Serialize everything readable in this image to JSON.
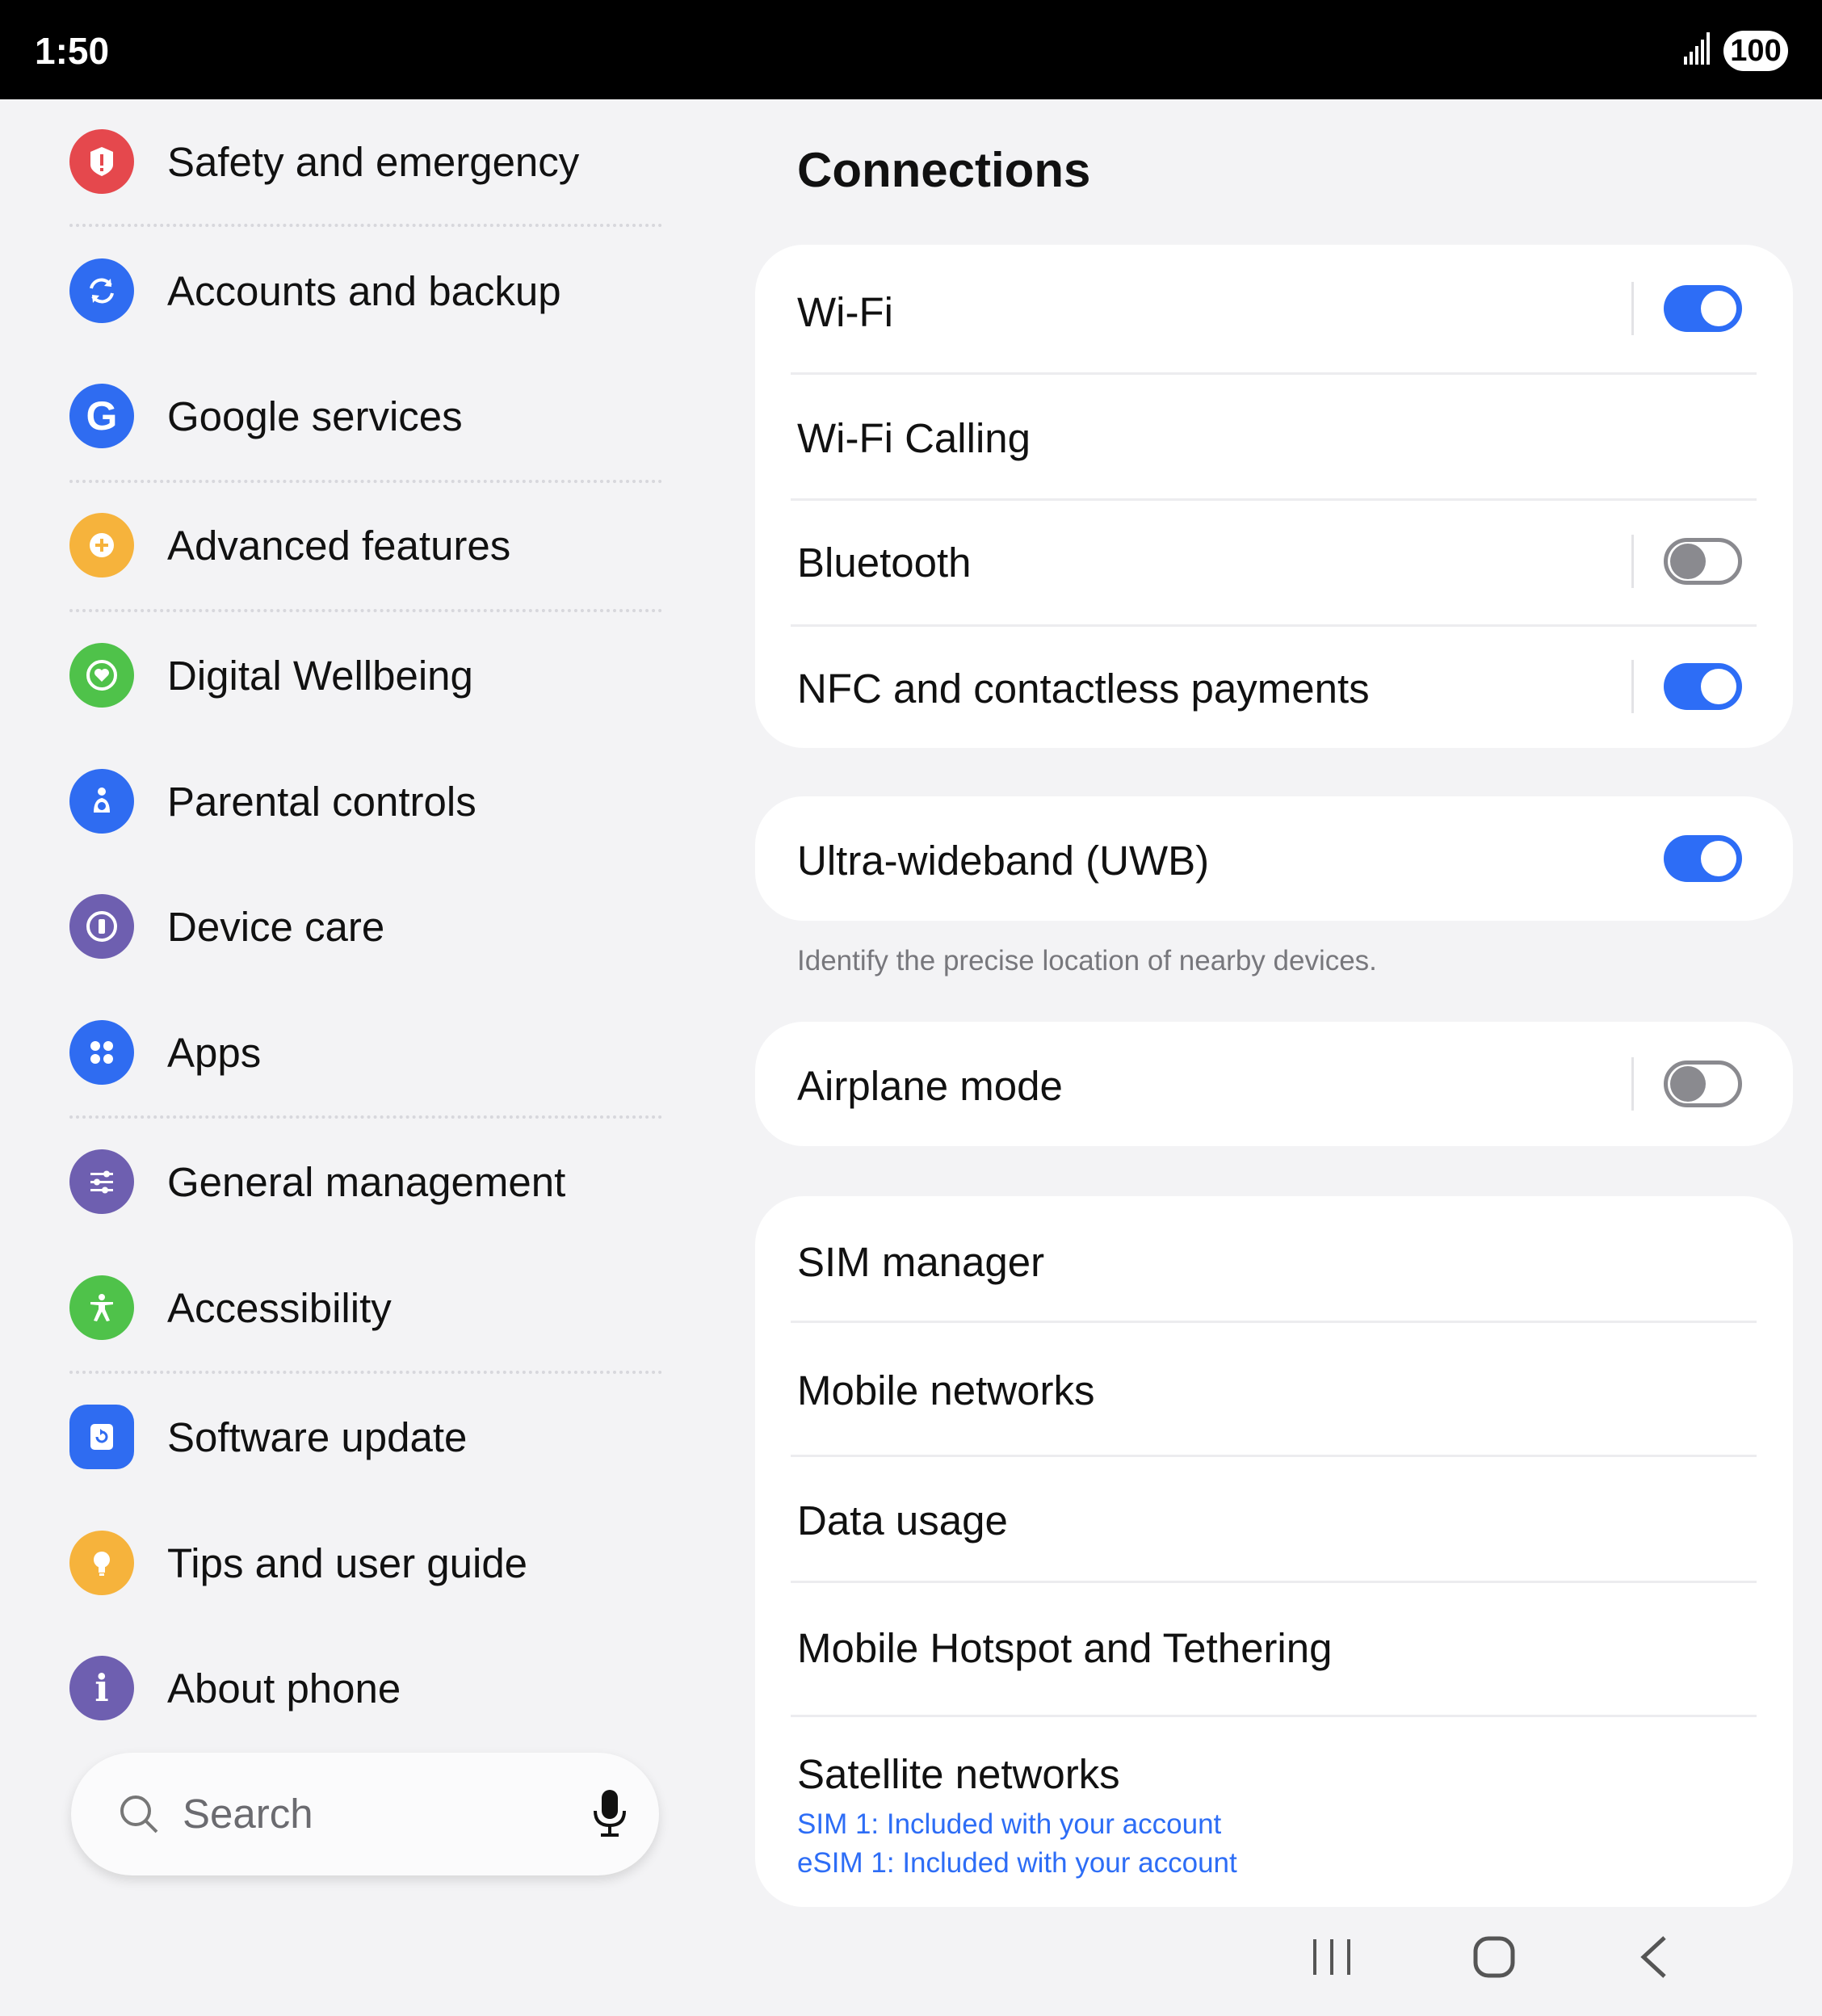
{
  "status_bar": {
    "time": "1:50",
    "battery": "100"
  },
  "sidebar": {
    "items": [
      {
        "label": "Safety and emergency",
        "icon": "alert-icon",
        "color": "#e5484d"
      },
      {
        "label": "Accounts and backup",
        "icon": "sync-icon",
        "color": "#2f6cf1"
      },
      {
        "label": "Google services",
        "icon": "google-icon",
        "color": "#2f6cf1"
      },
      {
        "label": "Advanced features",
        "icon": "gear-plus-icon",
        "color": "#f6b33c"
      },
      {
        "label": "Digital Wellbeing",
        "icon": "heart-ring-icon",
        "color": "#4fc24a"
      },
      {
        "label": "Parental controls",
        "icon": "parent-child-icon",
        "color": "#2f6cf1"
      },
      {
        "label": "Device care",
        "icon": "device-care-icon",
        "color": "#6e5fb0"
      },
      {
        "label": "Apps",
        "icon": "apps-grid-icon",
        "color": "#2f6cf1"
      },
      {
        "label": "General management",
        "icon": "sliders-icon",
        "color": "#6e5fb0"
      },
      {
        "label": "Accessibility",
        "icon": "accessibility-icon",
        "color": "#4fc24a"
      },
      {
        "label": "Software update",
        "icon": "software-update-icon",
        "color": "#2f6cf1"
      },
      {
        "label": "Tips and user guide",
        "icon": "lightbulb-icon",
        "color": "#f6b33c"
      },
      {
        "label": "About phone",
        "icon": "info-icon",
        "color": "#6e5fb0"
      }
    ]
  },
  "search": {
    "placeholder": "Search"
  },
  "main": {
    "title": "Connections",
    "group1": [
      {
        "label": "Wi-Fi",
        "toggle": true
      },
      {
        "label": "Wi-Fi Calling"
      },
      {
        "label": "Bluetooth",
        "toggle": false
      },
      {
        "label": "NFC and contactless payments",
        "toggle": true
      }
    ],
    "uwb": {
      "label": "Ultra-wideband (UWB)",
      "toggle": true,
      "description": "Identify the precise location of nearby devices."
    },
    "airplane": {
      "label": "Airplane mode",
      "toggle": false
    },
    "group3": [
      {
        "label": "SIM manager"
      },
      {
        "label": "Mobile networks"
      },
      {
        "label": "Data usage"
      },
      {
        "label": "Mobile Hotspot and Tethering"
      },
      {
        "label": "Satellite networks",
        "sub1": "SIM 1: Included with your account",
        "sub2": "eSIM 1: Included with your account"
      }
    ]
  },
  "colors": {
    "accent": "#2d6df6",
    "background": "#f3f3f5",
    "card": "#ffffff"
  }
}
